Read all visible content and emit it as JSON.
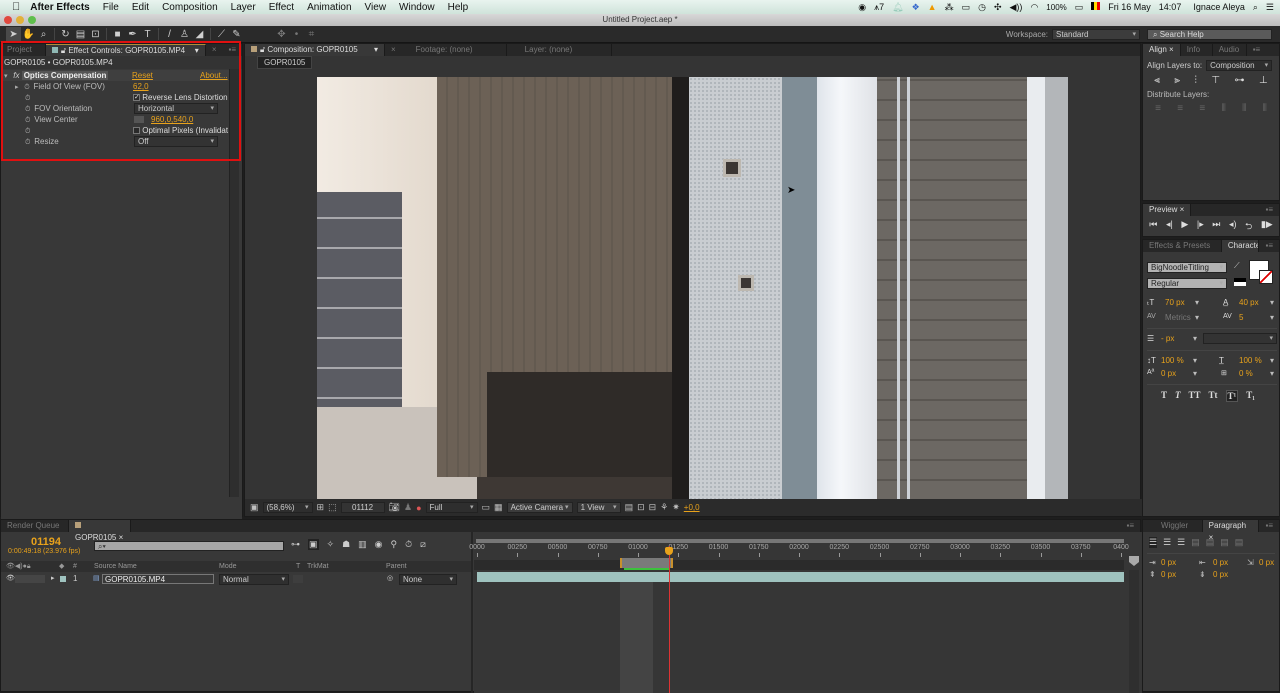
{
  "menubar": {
    "apple": "",
    "app": "After Effects",
    "items": [
      "File",
      "Edit",
      "Composition",
      "Layer",
      "Effect",
      "Animation",
      "View",
      "Window",
      "Help"
    ],
    "status": {
      "adobe_count": "7",
      "battery": "100%",
      "date": "Fri 16 May",
      "time": "14:07",
      "user": "Ignace Aleya"
    }
  },
  "window": {
    "title": "Untitled Project.aep *"
  },
  "toolbar": {
    "workspace_label": "Workspace:",
    "workspace_value": "Standard",
    "search_placeholder": "Search Help"
  },
  "left_panel": {
    "tabs": {
      "project": "Project",
      "effect_controls": "Effect Controls: GOPR0105.MP4"
    },
    "breadcrumb": "GOPR0105 • GOPR0105.MP4",
    "effect": {
      "name": "Optics Compensation",
      "reset": "Reset",
      "about": "About..."
    },
    "properties": [
      {
        "label": "Field Of View (FOV)",
        "value": "62,0"
      },
      {
        "label": "",
        "value": "Reverse Lens Distortion",
        "checked": true
      },
      {
        "label": "FOV Orientation",
        "value": "Horizontal"
      },
      {
        "label": "View Center",
        "value": "960,0,540,0"
      },
      {
        "label": "",
        "value": "Optimal Pixels (Invalidat",
        "checked": false
      },
      {
        "label": "Resize",
        "value": "Off"
      }
    ]
  },
  "comp_panel": {
    "tabs": {
      "composition": "Composition: GOPR0105",
      "footage": "Footage: (none)",
      "layer": "Layer: (none)"
    },
    "comp_name": "GOPR0105",
    "footer": {
      "zoom": "(58,6%)",
      "frame": "01112",
      "resolution": "Full",
      "camera": "Active Camera",
      "views": "1 View",
      "exposure": "+0,0"
    }
  },
  "align_panel": {
    "tabs": {
      "align": "Align",
      "info": "Info",
      "audio": "Audio"
    },
    "align_to_label": "Align Layers to:",
    "align_to_value": "Composition",
    "distribute_label": "Distribute Layers:"
  },
  "preview_panel": {
    "tab": "Preview"
  },
  "character_panel": {
    "tabs": {
      "effects": "Effects & Presets",
      "character": "Character"
    },
    "font": "BigNoodleTitling",
    "style": "Regular",
    "font_size": "70 px",
    "leading": "40 px",
    "kerning": "Metrics",
    "tracking": "5",
    "stroke": "- px",
    "vscale": "100 %",
    "hscale": "100 %",
    "baseline": "0 px",
    "tsume": "0 %",
    "styles": [
      "T",
      "T",
      "TT",
      "Tt",
      "T¹",
      "T₁"
    ]
  },
  "timeline": {
    "tabs": {
      "render_queue": "Render Queue",
      "comp": "GOPR0105"
    },
    "current_frame": "01194",
    "timecode": "0:00:49:18 (23.976 fps)",
    "columns": {
      "num": "#",
      "source": "Source Name",
      "mode": "Mode",
      "t": "T",
      "trkmat": "TrkMat",
      "parent": "Parent"
    },
    "layers": [
      {
        "num": "1",
        "name": "GOPR0105.MP4",
        "mode": "Normal",
        "parent": "None"
      }
    ],
    "ruler": [
      "0000",
      "00250",
      "00500",
      "00750",
      "01000",
      "01250",
      "01500",
      "01750",
      "02000",
      "02250",
      "02500",
      "02750",
      "03000",
      "03250",
      "03500",
      "03750",
      "0400"
    ],
    "playhead_frame": 1194,
    "work_area": [
      890,
      1220
    ],
    "max_frame": 4000
  },
  "paragraph_panel": {
    "tabs": {
      "wiggler": "Wiggler",
      "paragraph": "Paragraph"
    },
    "values": [
      "0 px",
      "0 px",
      "0 px",
      "0 px",
      "0 px"
    ]
  }
}
